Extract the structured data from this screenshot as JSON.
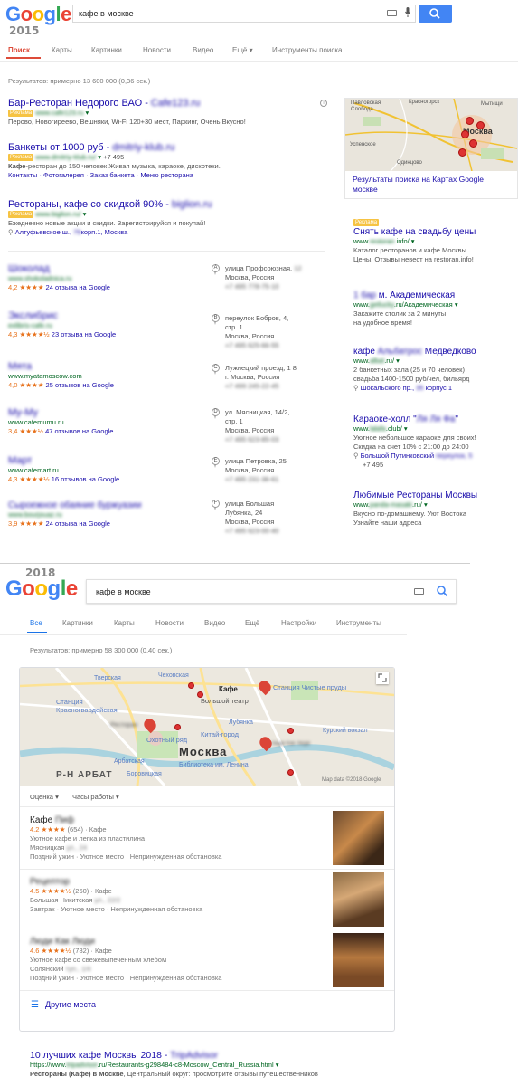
{
  "v2015": {
    "year": "2015",
    "query": "кафе в москве",
    "tabs": [
      "Поиск",
      "Карты",
      "Картинки",
      "Новости",
      "Видео",
      "Ещё",
      "Инструменты поиска"
    ],
    "stats": "Результатов: примерно 13 600 000 (0,36 сек.)",
    "ad_label": "Реклама",
    "ads": [
      {
        "title_a": "Бар-Ресторан Недорого ВАО - ",
        "title_b": "Cafe123.ru",
        "url": "www.cafe123.ru",
        "desc": "Перово, Новогиреево, Вешняки, Wi-Fi 120+30 мест, Паркинг, Очень Вкусно!"
      },
      {
        "title_a": "Банкеты от 1000 руб - ",
        "title_b": "dmitriy-klub.ru",
        "url": "www.dmitriy-klub.ru/",
        "phone": "+7 495",
        "desc_bold": "Кафе",
        "desc": "-ресторан до 150 человек Живая музыка, караоке, дискотеки.",
        "links": "Контакты · Фотогалерея · Заказ банкета · Меню ресторана"
      },
      {
        "title_a": "Рестораны, кафе со скидкой 90% - ",
        "title_b": "biglion.ru",
        "url": "www.biglion.ru/",
        "desc": "Ежедневно новые акции и скидки. Зарегистрируйся и покупай!",
        "addr_a": "Алтуфьевское ш., ",
        "addr_b": "79",
        "addr_c": "корп.1, Москва"
      }
    ],
    "local": [
      {
        "name": "Шоколад",
        "url": "www.shokoladnica.ru",
        "rating": "4,2",
        "stars": "★★★★",
        "reviews": "24 отзыва на Google",
        "letter": "A",
        "addr": [
          "улица Профсоюзная,",
          "12",
          "Москва, Россия",
          "+7 495 778-75-10"
        ]
      },
      {
        "name": "Экслибрис",
        "url": "exlibris-cafe.ru",
        "rating": "4,3",
        "stars": "★★★★½",
        "reviews": "23 отзыва на Google",
        "letter": "B",
        "addr": [
          "переулок Бобров, 4,",
          "стр. 1",
          "Москва, Россия",
          "+7 495 625-66-55"
        ]
      },
      {
        "name": "Мята",
        "url": "www.myatamoscow.com",
        "rating": "4,0",
        "stars": "★★★★",
        "reviews": "25 отзывов на Google",
        "letter": "C",
        "addr": [
          "Лужнецкий проезд, 1 8",
          "г. Москва, Россия",
          "+7 499 245-22-45"
        ]
      },
      {
        "name": "My-My",
        "url": "www.cafemumu.ru",
        "rating": "3,4",
        "stars": "★★★½",
        "reviews": "47 отзывов на Google",
        "letter": "D",
        "addr": [
          "ул. Мясницкая, 14/2,",
          "стр. 1",
          "Москва, Россия",
          "+7 495 623-85-03"
        ]
      },
      {
        "name": "Март",
        "url": "www.cafemart.ru",
        "rating": "4,3",
        "stars": "★★★★½",
        "reviews": "16 отзывов на Google",
        "letter": "E",
        "addr": [
          "улица Петровка, 25",
          "Москва, Россия",
          "+7 495 231-36-61"
        ]
      },
      {
        "name": "Сыроежное обаяние буржуазии",
        "url": "www.bourjouaz.ru",
        "rating": "3,9",
        "stars": "★★★★",
        "reviews": "24 отзыва на Google",
        "letter": "F",
        "addr": [
          "улица Большая",
          "Лубянка, 24",
          "Москва, Россия",
          "+7 495 623-00-40"
        ]
      }
    ],
    "map_caption": "Результаты поиска на Картах Google москве",
    "map_labels": [
      "Павловская Слобода",
      "Красногорск",
      "Мытищи",
      "Москва",
      "Одинцово",
      "Успенское"
    ],
    "side_ads": [
      {
        "title": "Снять кафе на свадьбу цены",
        "url_a": "www.",
        "url_b": "restoran",
        "url_c": ".info/",
        "lines": [
          "Каталог ресторанов и кафе Москвы.",
          "Цены. Отзывы невест на restoran.info!"
        ]
      },
      {
        "title_a": "1 бар ",
        "title_b": "м. Академическая",
        "url_a": "www.",
        "url_b": "getlucky",
        "url_c": ".ru/Академическая",
        "lines": [
          "Закажите столик за 2 минуты",
          "на удобное время!"
        ]
      },
      {
        "title_a": "кафе ",
        "title_b": "Альбатрос",
        "title_c": " Медведково",
        "url_a": "www.",
        "url_b": "albat",
        "url_c": ".ru/",
        "lines": [
          "2 банкетных зала (25 и 70 человек)",
          "свадьба 1400-1500 руб/чел, бильярд"
        ],
        "addr_a": "Шокальского пр., ",
        "addr_b": "35",
        "addr_c": " корпус 1"
      },
      {
        "title_a": "Караоке-холл \"",
        "title_b": "Ля Ля Фа",
        "title_c": "\"",
        "url_a": "www.",
        "url_b": "lalafa",
        "url_c": ".club/",
        "lines": [
          "Уютное небольшое караоке для своих!",
          "Скидка на счет 10% с 21:00 до 24:00"
        ],
        "addr_a": "Большой Путинковский ",
        "addr_b": "переулок, 5",
        "phone": "+7 495"
      },
      {
        "title": "Любимые Рестораны Москвы",
        "url_a": "www.",
        "url_b": "panda-masaki",
        "url_c": ".ru/",
        "lines": [
          "Вкусно по-домашнему. Уют Востока",
          "Узнайте наши адреса"
        ]
      }
    ]
  },
  "v2018": {
    "year": "2018",
    "query": "кафе в москве",
    "tabs": [
      "Все",
      "Картинки",
      "Карты",
      "Новости",
      "Видео",
      "Ещё",
      "Настройки",
      "Инструменты"
    ],
    "stats": "Результатов: примерно 58 300 000 (0,40 сек.)",
    "map_labels": [
      "Тверская",
      "Чеховская",
      "Станция Чистые пруды",
      "Станция Красногвардейская",
      "Кафе",
      "Большой театр",
      "Ресторан",
      "Лубянка",
      "Курский вокзал",
      "Охотный ряд",
      "Китай-город",
      "Москва",
      "Арбатская",
      "Библиотека им. Ленина",
      "Р-Н АРБАТ",
      "Боровицкая",
      "Люди Как Люди"
    ],
    "map_credit": "Map data ©2018 Google",
    "filters": [
      "Оценка",
      "Часы работы"
    ],
    "places": [
      {
        "name_a": "Кафе ",
        "name_b": "Пиф",
        "rating": "4.2",
        "stars": "★★★★",
        "meta": "(654) · Кафе",
        "desc": "Уютное кафе и лепка из пластилина",
        "addr_a": "Мясницкая ",
        "addr_b": "ул., 24",
        "tags": "Поздний ужин · Уютное место · Непринужденная обстановка"
      },
      {
        "name_a": "Рецептор",
        "name_b": "",
        "rating": "4.5",
        "stars": "★★★★½",
        "meta": "(260) · Кафе",
        "desc": "",
        "addr_a": "Большая Никитская ",
        "addr_b": "ул., 22/2",
        "tags": "Завтрак · Уютное место · Непринужденная обстановка"
      },
      {
        "name_a": "Люди Как Люди",
        "name_b": "",
        "rating": "4.6",
        "stars": "★★★★½",
        "meta": "(782) · Кафе",
        "desc": "Уютное кафе со свежевыпеченным хлебом",
        "addr_a": "Солянский ",
        "addr_b": "туп., 1/4",
        "tags": "Поздний ужин · Уютное место · Непринужденная обстановка"
      }
    ],
    "more_places": "Другие места",
    "organic": {
      "title_a": "10 лучших кафе Москвы 2018 - ",
      "title_b": "TripAdvisor",
      "url_a": "https://www.",
      "url_b": "tripadvisor",
      "url_c": ".ru/Restaurants-g298484-c8-Moscow_Central_Russia.html",
      "desc_a": "Рестораны (Кафе) в Москве",
      "desc_b": ", Центральный округ: просмотрите отзывы путешественников"
    }
  }
}
